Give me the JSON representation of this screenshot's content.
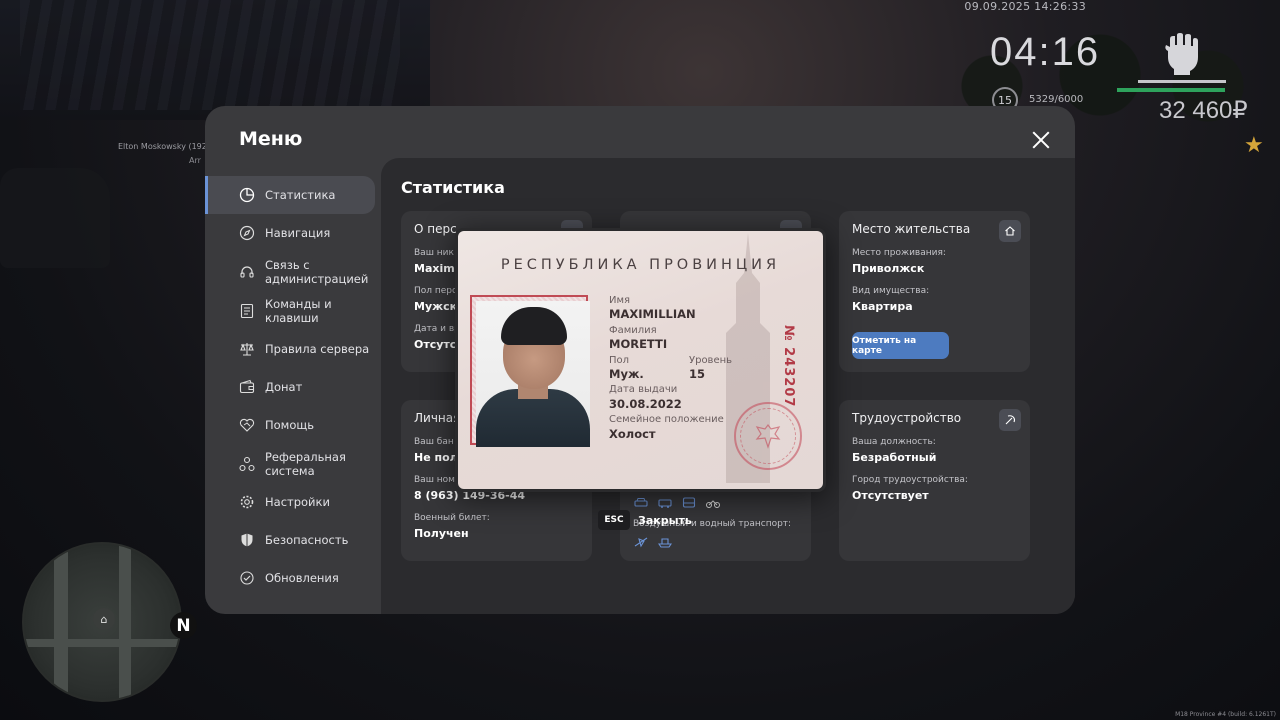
{
  "hud": {
    "datetime": "09.09.2025 14:26:33",
    "clock": "04:16",
    "level": "15",
    "xp": "5329/6000",
    "money": "32 460₽",
    "player_name": "Elton Moskowsky (192",
    "player_sub": "Arr",
    "compass": "N",
    "build": "M18 Province #4 (build: 6.1261T)",
    "colors": {
      "health_bar": "#2ea35c",
      "accent": "#6b93d6",
      "star": "#d4a53a"
    }
  },
  "menu": {
    "title": "Меню",
    "close_icon": "close-icon",
    "nav": [
      {
        "label": "Статистика",
        "icon": "chart-pie-icon",
        "active": true
      },
      {
        "label": "Навигация",
        "icon": "compass-icon"
      },
      {
        "label": "Связь с администрацией",
        "icon": "headset-icon"
      },
      {
        "label": "Команды и клавиши",
        "icon": "list-icon"
      },
      {
        "label": "Правила сервера",
        "icon": "scales-icon"
      },
      {
        "label": "Донат",
        "icon": "wallet-icon"
      },
      {
        "label": "Помощь",
        "icon": "handshake-icon"
      },
      {
        "label": "Реферальная система",
        "icon": "network-icon"
      },
      {
        "label": "Настройки",
        "icon": "gear-icon"
      },
      {
        "label": "Безопасность",
        "icon": "shield-icon"
      },
      {
        "label": "Обновления",
        "icon": "refresh-icon"
      }
    ]
  },
  "content": {
    "title": "Статистика",
    "personal": {
      "title": "О перс",
      "nick_label": "Ваш ник",
      "nick_value": "Maxim",
      "gender_label": "Пол перс",
      "gender_value": "Мужск",
      "date_label": "Дата и вр",
      "date_value": "Отсутс"
    },
    "finance": {
      "title": "Личная",
      "bank_label": "Ваш бан",
      "bank_value": "Не пол",
      "phone_label": "Ваш ном",
      "phone_value": "8 (963) 149-36-44",
      "military_label": "Военный билет:",
      "military_value": "Получен"
    },
    "residence": {
      "title": "Место жительства",
      "icon": "home-icon",
      "place_label": "Место проживания:",
      "place_value": "Приволжск",
      "property_label": "Вид имущества:",
      "property_value": "Квартира",
      "map_button": "Отметить на карте"
    },
    "transport": {
      "air_water_label": "Воздушный и водный транспорт:"
    },
    "employment": {
      "title": "Трудоустройство",
      "icon": "pickaxe-icon",
      "position_label": "Ваша должность:",
      "position_value": "Безработный",
      "city_label": "Город трудоустройства:",
      "city_value": "Отсутствует"
    }
  },
  "passport": {
    "header": "РЕСПУБЛИКА ПРОВИНЦИЯ",
    "name_label": "Имя",
    "name_value": "MAXIMILLIAN",
    "surname_label": "Фамилия",
    "surname_value": "MORETTI",
    "gender_label": "Пол",
    "gender_value": "Муж.",
    "level_label": "Уровень",
    "level_value": "15",
    "issue_label": "Дата выдачи",
    "issue_value": "30.08.2022",
    "marital_label": "Семейное положение",
    "marital_value": "Холост",
    "number": "№ 243207",
    "accent_color": "#b23a46"
  },
  "close_hint": {
    "key": "ESC",
    "label": "Закрыть"
  }
}
